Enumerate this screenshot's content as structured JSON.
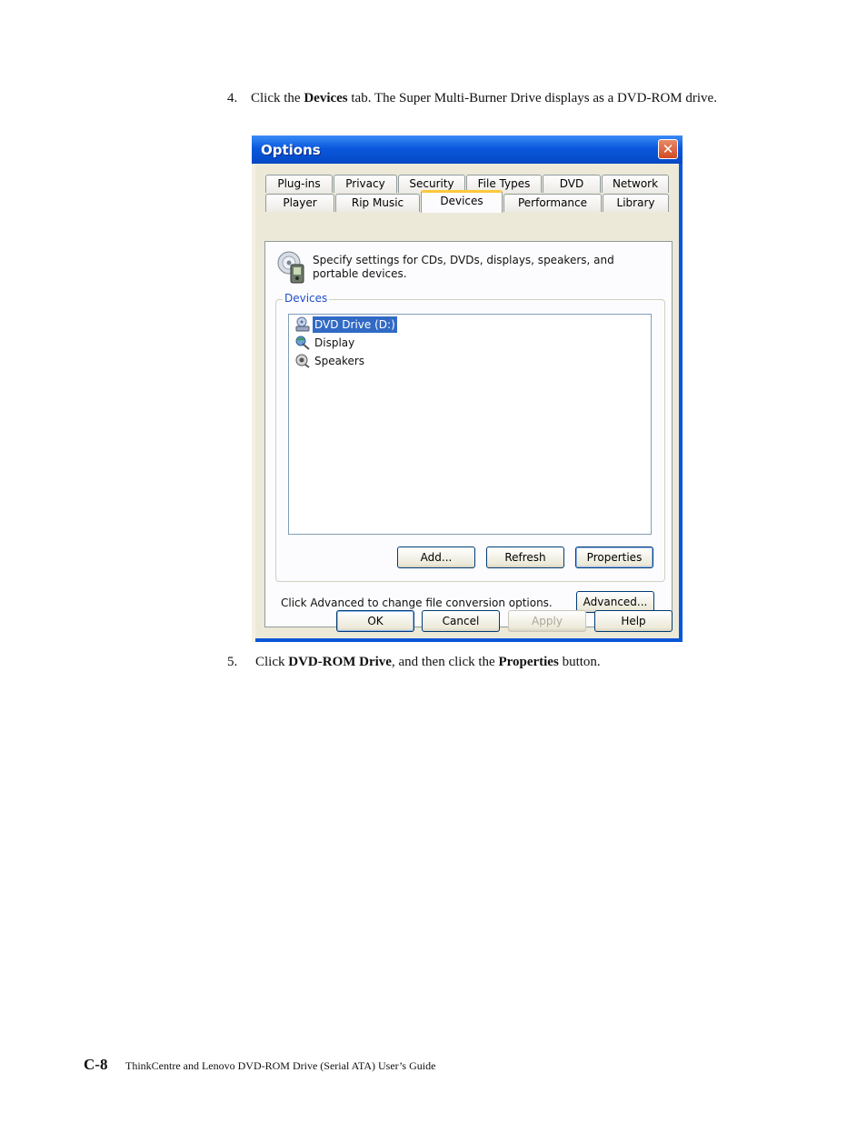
{
  "step4": {
    "number": "4.",
    "text_a": "Click the ",
    "bold_a": "Devices",
    "text_b": " tab. The Super Multi-Burner Drive displays as a DVD-ROM drive."
  },
  "dialog": {
    "title": "Options",
    "close_icon": "close-icon",
    "tabs_row1": [
      "Plug-ins",
      "Privacy",
      "Security",
      "File Types",
      "DVD",
      "Network"
    ],
    "tabs_row2": [
      "Player",
      "Rip Music",
      "Devices",
      "Performance",
      "Library"
    ],
    "active_tab": "Devices",
    "description": "Specify settings for CDs, DVDs, displays, speakers, and portable devices.",
    "group_label": "Devices",
    "devices": [
      {
        "label": "DVD Drive (D:)",
        "icon": "dvd-drive-icon",
        "selected": true
      },
      {
        "label": "Display",
        "icon": "display-icon",
        "selected": false
      },
      {
        "label": "Speakers",
        "icon": "speakers-icon",
        "selected": false
      }
    ],
    "add_label": "Add...",
    "refresh_label": "Refresh",
    "properties_label": "Properties",
    "advanced_text": "Click Advanced to change file conversion options.",
    "advanced_label": "Advanced...",
    "ok_label": "OK",
    "cancel_label": "Cancel",
    "apply_label": "Apply",
    "help_label": "Help"
  },
  "step5": {
    "number": "5.",
    "text_a": "Click ",
    "bold_a": "DVD-ROM Drive",
    "text_b": ", and then click the ",
    "bold_b": "Properties",
    "text_c": " button."
  },
  "footer": {
    "page_number": "C-8",
    "book_title": "ThinkCentre and Lenovo DVD-ROM Drive (Serial ATA) User’s Guide"
  }
}
